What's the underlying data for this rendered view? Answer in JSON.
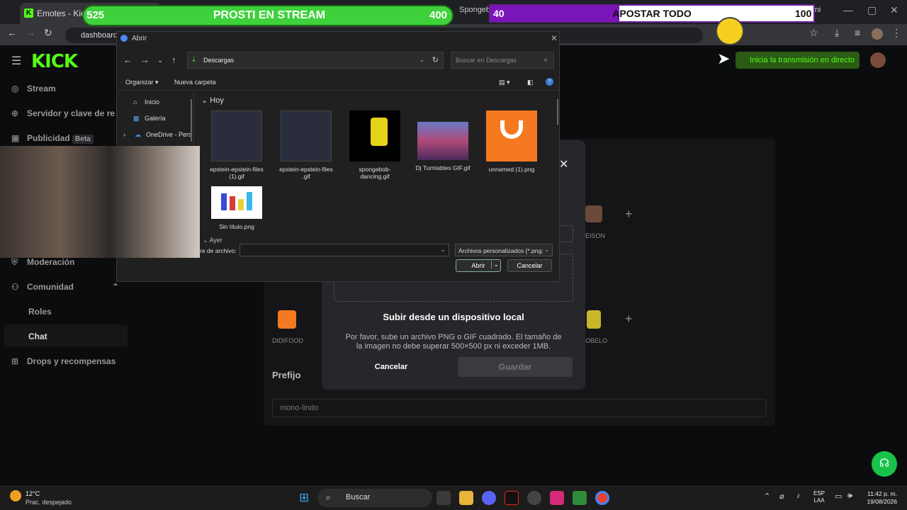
{
  "browser": {
    "active_tab": "Emotes - Kick D",
    "tab2": "Spongeb",
    "tab3": "Pregúntale a Gemini",
    "url": "dashboard",
    "win_min": "—",
    "win_max": "▢",
    "win_close": "✕"
  },
  "kick": {
    "logo": "KICK",
    "go_live": "Inicia la transmisión en directo",
    "sidebar": [
      {
        "label": "Stream",
        "icon": "stream-icon"
      },
      {
        "label": "Servidor y clave de re",
        "icon": "server-icon"
      },
      {
        "label": "Publicidad",
        "icon": "ads-icon",
        "badge": "Beta"
      },
      {
        "label": "Moderación",
        "icon": "shield-icon"
      },
      {
        "label": "Comunidad",
        "icon": "community-icon"
      },
      {
        "label": "Roles",
        "icon": ""
      },
      {
        "label": "Chat",
        "icon": ""
      },
      {
        "label": "Drops y recompensas",
        "icon": "gift-icon"
      }
    ],
    "prefix_label": "Prefijo",
    "prefix_value": "mono-lindo",
    "emotes": [
      "DIDIFOOD",
      "EISON",
      "OBELO"
    ]
  },
  "upload_modal": {
    "title": "Subir desde un dispositivo local",
    "description": "Por favor, sube un archivo PNG o GIF cuadrado. El tamaño de la imagen no debe superar 500×500 px ni exceder 1MB.",
    "cancel": "Cancelar",
    "save": "Guardar"
  },
  "file_dialog": {
    "title": "Abrir",
    "path": "Descargas",
    "search_placeholder": "Buscar en Descargas",
    "organize": "Organizar",
    "new_folder": "Nueva carpeta",
    "nav": [
      {
        "label": "Inicio",
        "icon": "home-icon"
      },
      {
        "label": "Galería",
        "icon": "gallery-icon"
      },
      {
        "label": "OneDrive - Pers",
        "icon": "cloud-icon"
      }
    ],
    "group_today": "Hoy",
    "group_yesterday": "Ayer",
    "files": [
      {
        "name": "epstein-epstein-files (1).gif",
        "color": "#2a2d3c"
      },
      {
        "name": "epstein-epstein-files .gif",
        "color": "#2a2d3c"
      },
      {
        "name": "spongebob-dancing.gif",
        "color": "#000000"
      },
      {
        "name": "Dj Turntables GIF.gif",
        "color": "#7a3a5e"
      },
      {
        "name": "unnamed (1).png",
        "color": "#f47920"
      },
      {
        "name": "Sin título.png",
        "color": "#ffffff"
      }
    ],
    "filename_label": "re de archivo:",
    "filetype": "Archivos personalizados (*.png;",
    "open": "Abrir",
    "cancel": "Cancelar"
  },
  "overlay": {
    "left_bar": {
      "left": "525",
      "title": "PROSTI EN STREAM",
      "right": "400"
    },
    "right_bar": {
      "left": "40",
      "title": "APOSTAR TODO",
      "right": "100",
      "fill": 0.4
    }
  },
  "taskbar": {
    "temp": "12°C",
    "weather": "Prac. despejado",
    "search": "Buscar",
    "lang1": "ESP",
    "lang2": "LAA",
    "time": "11:42 p. m.",
    "date": "19/08/2026"
  }
}
